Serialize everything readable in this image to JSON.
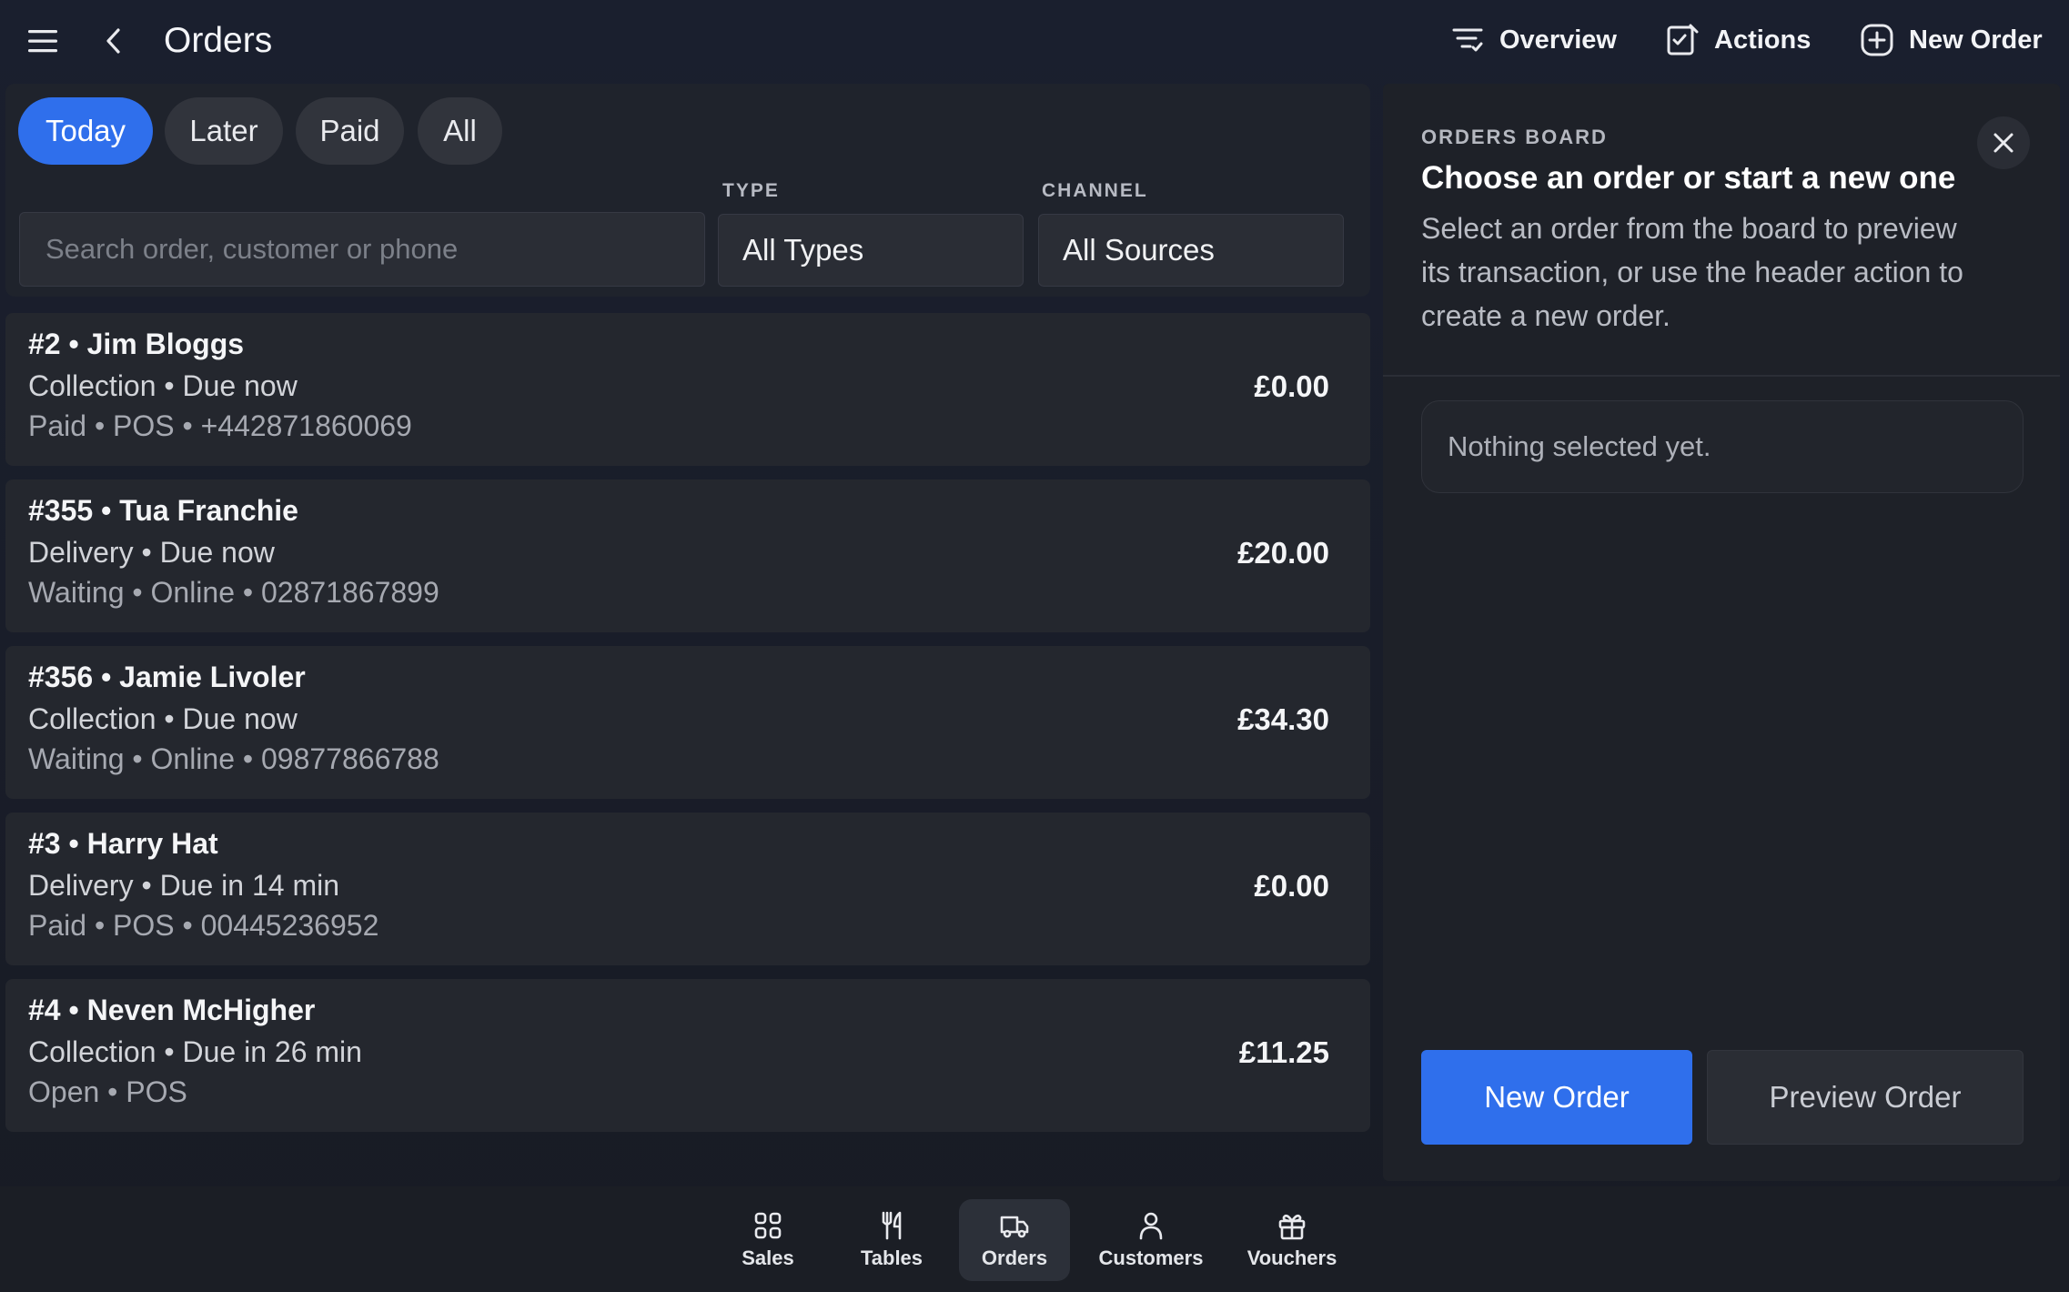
{
  "header": {
    "title": "Orders",
    "actions": [
      {
        "label": "Overview",
        "icon": "filter-list-icon"
      },
      {
        "label": "Actions",
        "icon": "checklist-edit-icon"
      },
      {
        "label": "New Order",
        "icon": "add-circle-icon"
      }
    ]
  },
  "filters": {
    "chips": [
      "Today",
      "Later",
      "Paid",
      "All"
    ],
    "active_chip": "Today",
    "search_placeholder": "Search order, customer or phone",
    "type_label": "TYPE",
    "type_value": "All Types",
    "channel_label": "CHANNEL",
    "channel_value": "All Sources"
  },
  "orders": [
    {
      "title": "#2 • Jim Bloggs",
      "sub": "Collection • Due now",
      "meta": "Paid • POS • +442871860069",
      "amount": "£0.00"
    },
    {
      "title": "#355 • Tua Franchie",
      "sub": "Delivery • Due now",
      "meta": "Waiting • Online • 02871867899",
      "amount": "£20.00"
    },
    {
      "title": "#356 • Jamie Livoler",
      "sub": "Collection • Due now",
      "meta": "Waiting • Online • 09877866788",
      "amount": "£34.30"
    },
    {
      "title": "#3 • Harry Hat",
      "sub": "Delivery • Due in 14 min",
      "meta": "Paid • POS • 00445236952",
      "amount": "£0.00"
    },
    {
      "title": "#4 • Neven McHigher",
      "sub": "Collection • Due in 26 min",
      "meta": "Open • POS",
      "amount": "£11.25"
    }
  ],
  "board": {
    "label": "ORDERS BOARD",
    "title": "Choose an order or start a new one",
    "description": "Select an order from the board to preview its transaction, or use the header action to create a new order.",
    "empty_text": "Nothing selected yet.",
    "primary_button": "New Order",
    "secondary_button": "Preview Order"
  },
  "nav": {
    "items": [
      {
        "label": "Sales",
        "icon": "grid-icon"
      },
      {
        "label": "Tables",
        "icon": "cutlery-icon"
      },
      {
        "label": "Orders",
        "icon": "delivery-truck-icon"
      },
      {
        "label": "Customers",
        "icon": "person-icon"
      },
      {
        "label": "Vouchers",
        "icon": "gift-icon"
      }
    ],
    "active": "Orders"
  },
  "colors": {
    "accent": "#2f6fec",
    "background": "#1a1f2e",
    "card": "#24272e"
  }
}
